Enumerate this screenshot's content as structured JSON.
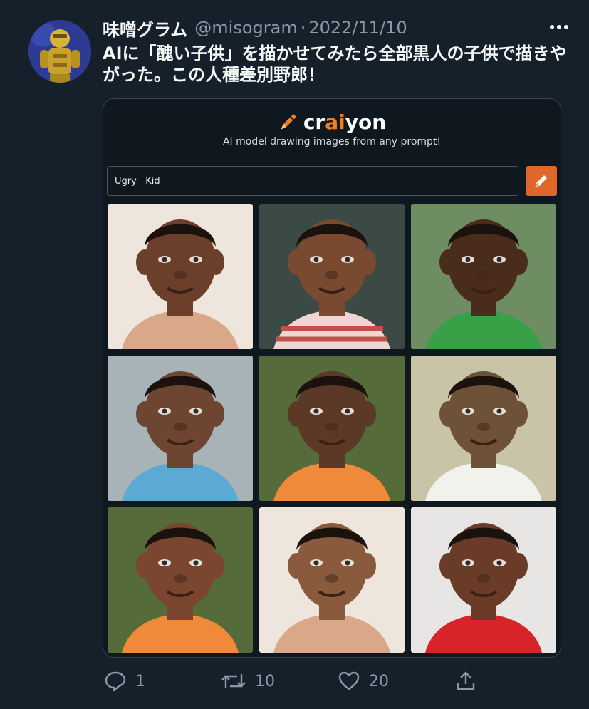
{
  "author": {
    "name": "味噌グラム",
    "handle": "@misogram",
    "separator": "·",
    "date": "2022/11/10"
  },
  "tweet": {
    "text": "AIに「醜い子供」を描かせてみたら全部黒人の子供で描きやがった。この人種差別野郎！"
  },
  "card": {
    "logo_prefix": "cr",
    "logo_ai": "ai",
    "logo_suffix": "yon",
    "tagline": "AI model drawing images from any prompt!",
    "prompt_value": "Ugry   Kid",
    "accent": "#e0672a",
    "images": [
      {
        "icon": "child-portrait",
        "shirt": "none"
      },
      {
        "icon": "child-portrait",
        "shirt": "striped"
      },
      {
        "icon": "child-portrait",
        "shirt": "green"
      },
      {
        "icon": "child-portrait",
        "shirt": "blue"
      },
      {
        "icon": "child-portrait",
        "shirt": "orange"
      },
      {
        "icon": "child-portrait",
        "shirt": "white"
      },
      {
        "icon": "child-portrait",
        "shirt": "orange"
      },
      {
        "icon": "child-portrait",
        "shirt": "none"
      },
      {
        "icon": "child-portrait",
        "shirt": "red"
      }
    ]
  },
  "actions": {
    "reply_count": "1",
    "retweet_count": "10",
    "like_count": "20"
  }
}
